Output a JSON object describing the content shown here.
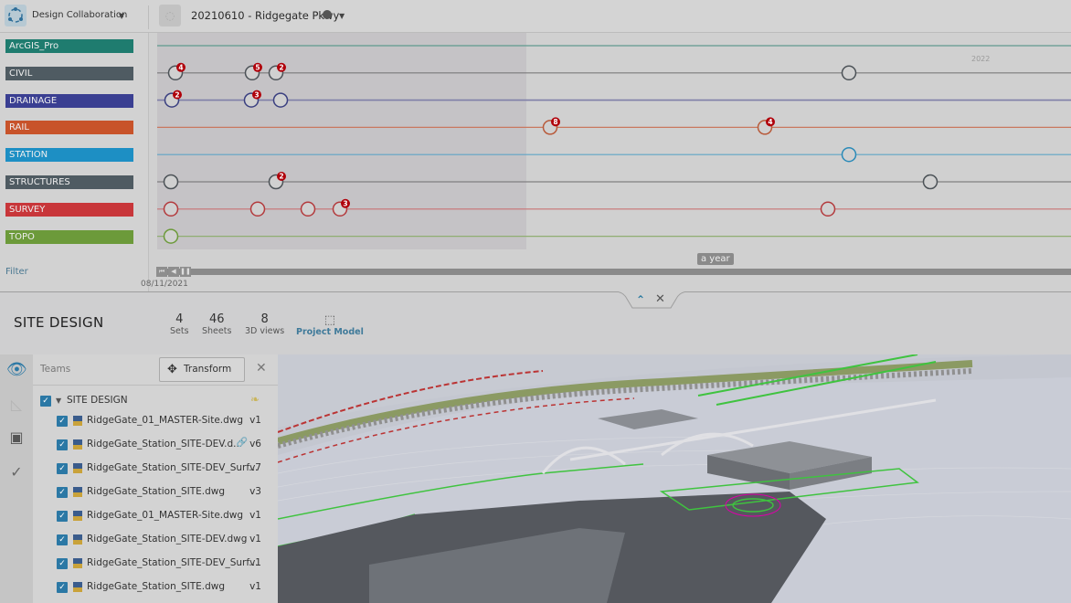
{
  "header": {
    "app_name": "Design Collaboration",
    "project_name": "20210610 - Ridgegate Pkwy"
  },
  "timeline": {
    "year_label": "2022",
    "date_label": "08/11/2021",
    "tooltip": "a year",
    "filter_label": "Filter",
    "teams": [
      {
        "name": "ArcGIS_Pro",
        "color": "#1f7c6f",
        "line": "#5f9a8e",
        "events": []
      },
      {
        "name": "CIVIL",
        "color": "#4f5b62",
        "line": "#7a7a7a",
        "events": [
          {
            "pos": 0.02,
            "badge": "4"
          },
          {
            "pos": 0.104,
            "badge": "5"
          },
          {
            "pos": 0.13,
            "badge": "2"
          },
          {
            "pos": 0.757,
            "badge": ""
          }
        ]
      },
      {
        "name": "DRAINAGE",
        "color": "#3a3f92",
        "line": "#7f7fa8",
        "events": [
          {
            "pos": 0.016,
            "badge": "2"
          },
          {
            "pos": 0.103,
            "badge": "3"
          },
          {
            "pos": 0.135,
            "badge": ""
          }
        ]
      },
      {
        "name": "RAIL",
        "color": "#c8532a",
        "line": "#c9785f",
        "events": [
          {
            "pos": 0.43,
            "badge": "8"
          },
          {
            "pos": 0.665,
            "badge": "4"
          }
        ]
      },
      {
        "name": "STATION",
        "color": "#1d8fc4",
        "line": "#5fa5c5",
        "events": [
          {
            "pos": 0.757,
            "badge": ""
          }
        ]
      },
      {
        "name": "STRUCTURES",
        "color": "#4f5b62",
        "line": "#7f7f7f",
        "events": [
          {
            "pos": 0.015,
            "badge": ""
          },
          {
            "pos": 0.13,
            "badge": "2"
          }
        ]
      },
      {
        "name": "SURVEY",
        "color": "#c8363a",
        "line": "#c97373",
        "events": [
          {
            "pos": 0.015,
            "badge": ""
          },
          {
            "pos": 0.11,
            "badge": ""
          },
          {
            "pos": 0.165,
            "badge": ""
          },
          {
            "pos": 0.2,
            "badge": "3"
          },
          {
            "pos": 0.734,
            "badge": ""
          }
        ]
      },
      {
        "name": "TOPO",
        "color": "#6c9a3a",
        "line": "#8fae72",
        "events": [
          {
            "pos": 0.015,
            "badge": ""
          }
        ]
      }
    ],
    "extra_events": [
      {
        "team": "STRUCTURES",
        "pos": 0.846,
        "badge": ""
      }
    ]
  },
  "site": {
    "title": "SITE DESIGN",
    "stats": [
      {
        "value": "4",
        "label": "Sets"
      },
      {
        "value": "46",
        "label": "Sheets"
      },
      {
        "value": "8",
        "label": "3D views"
      }
    ],
    "project_model_label": "Project Model"
  },
  "panel": {
    "teams_label": "Teams",
    "transform_label": "Transform",
    "group_label": "SITE DESIGN",
    "files": [
      {
        "name": "RidgeGate_01_MASTER-Site.dwg",
        "version": "v1",
        "linked": false
      },
      {
        "name": "RidgeGate_Station_SITE-DEV.d...",
        "version": "v6",
        "linked": true
      },
      {
        "name": "RidgeGate_Station_SITE-DEV_Surf...",
        "version": "v7",
        "linked": false
      },
      {
        "name": "RidgeGate_Station_SITE.dwg",
        "version": "v3",
        "linked": false
      },
      {
        "name": "RidgeGate_01_MASTER-Site.dwg",
        "version": "v1",
        "linked": false
      },
      {
        "name": "RidgeGate_Station_SITE-DEV.dwg",
        "version": "v1",
        "linked": false
      },
      {
        "name": "RidgeGate_Station_SITE-DEV_Surf...",
        "version": "v1",
        "linked": false
      },
      {
        "name": "RidgeGate_Station_SITE.dwg",
        "version": "v1",
        "linked": false
      }
    ]
  }
}
